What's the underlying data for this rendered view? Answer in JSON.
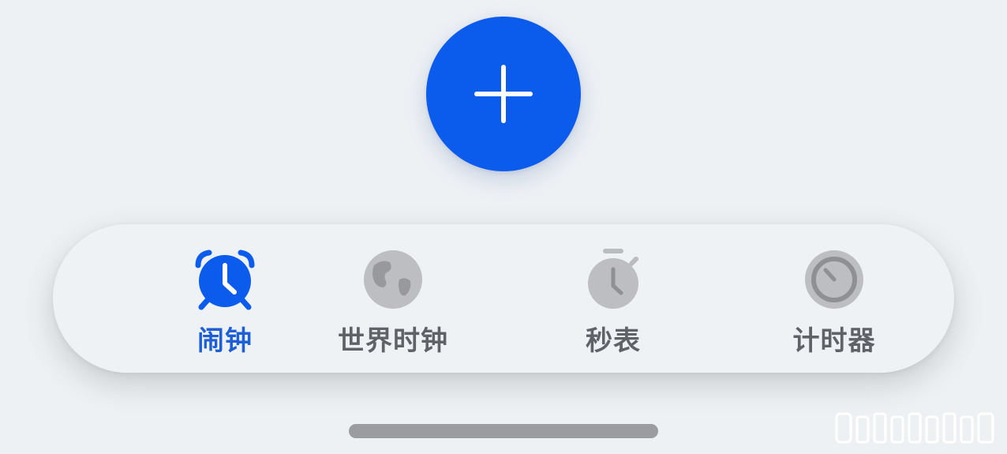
{
  "colors": {
    "accent": "#0b5ced",
    "active_label": "#1e5fd6",
    "inactive_icon": "#b9bbbf",
    "inactive_label": "#5f6266"
  },
  "fab": {
    "icon": "plus-icon"
  },
  "tabs": [
    {
      "label": "闹钟",
      "icon": "alarm-clock-icon",
      "active": true
    },
    {
      "label": "世界时钟",
      "icon": "globe-icon",
      "active": false
    },
    {
      "label": "秒表",
      "icon": "stopwatch-icon",
      "active": false
    },
    {
      "label": "计时器",
      "icon": "timer-icon",
      "active": false
    }
  ]
}
